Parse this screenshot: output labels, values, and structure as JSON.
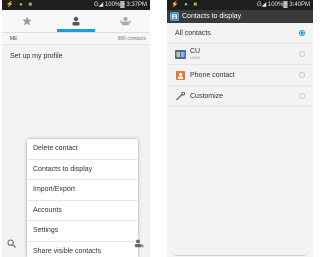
{
  "screen1": {
    "status": {
      "left_icons": "⚡ ● ■",
      "right_text": "G◢ 100%▓ 3:37PM"
    },
    "tabs": [
      "favorites-icon",
      "contacts-icon",
      "groups-icon"
    ],
    "subheader": {
      "left": "ME",
      "right": "986 contacts"
    },
    "profile_text": "Set up my profile",
    "menu_items": [
      "Delete contact",
      "Contacts to display",
      "Import/Export",
      "Accounts",
      "Settings",
      "Share visible contacts"
    ]
  },
  "screen2": {
    "status": {
      "left_icons": "⚡ ● ■",
      "right_text": "G◢ 100%▓ 3:40PM"
    },
    "title": "Contacts to display",
    "options": {
      "all_contacts": "All contacts",
      "cu": "CU",
      "cu_sub": "USIM",
      "phone_contact": "Phone contact",
      "customize": "Customize"
    },
    "selected": "All contacts",
    "colors": {
      "accent": "#1aa0d8",
      "action_bar": "#3a3a3a",
      "status_bar": "#1e1e1e"
    }
  }
}
